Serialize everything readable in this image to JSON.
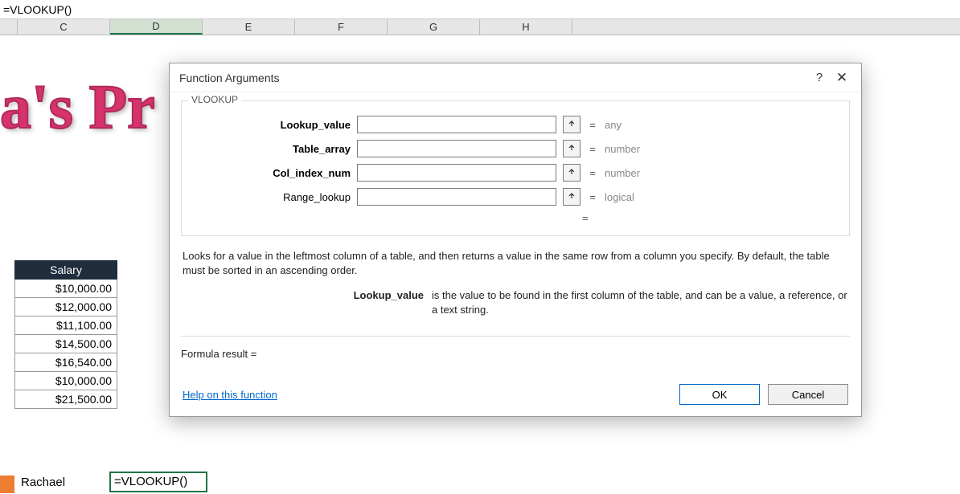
{
  "formula_bar": "=VLOOKUP()",
  "columns": [
    "C",
    "D",
    "E",
    "F",
    "G",
    "H"
  ],
  "selected_column_index": 1,
  "fancy_title": "a's Pr",
  "salary": {
    "header": "Salary",
    "rows": [
      "$10,000.00",
      "$12,000.00",
      "$11,100.00",
      "$14,500.00",
      "$16,540.00",
      "$10,000.00",
      "$21,500.00"
    ]
  },
  "bottom_label": "Rachael",
  "active_cell_formula": "=VLOOKUP()",
  "dialog": {
    "title": "Function Arguments",
    "function_name": "VLOOKUP",
    "args": [
      {
        "label": "Lookup_value",
        "bold": true,
        "value": "",
        "type": "any"
      },
      {
        "label": "Table_array",
        "bold": true,
        "value": "",
        "type": "number"
      },
      {
        "label": "Col_index_num",
        "bold": true,
        "value": "",
        "type": "number"
      },
      {
        "label": "Range_lookup",
        "bold": false,
        "value": "",
        "type": "logical"
      }
    ],
    "eq_symbol": "=",
    "description": "Looks for a value in the leftmost column of a table, and then returns a value in the same row from a column you specify. By default, the table must be sorted in an ascending order.",
    "param_label": "Lookup_value",
    "param_desc": "is the value to be found in the first column of the table, and can be a value, a reference, or a text string.",
    "formula_result_label": "Formula result =",
    "help_link": "Help on this function",
    "ok": "OK",
    "cancel": "Cancel"
  }
}
